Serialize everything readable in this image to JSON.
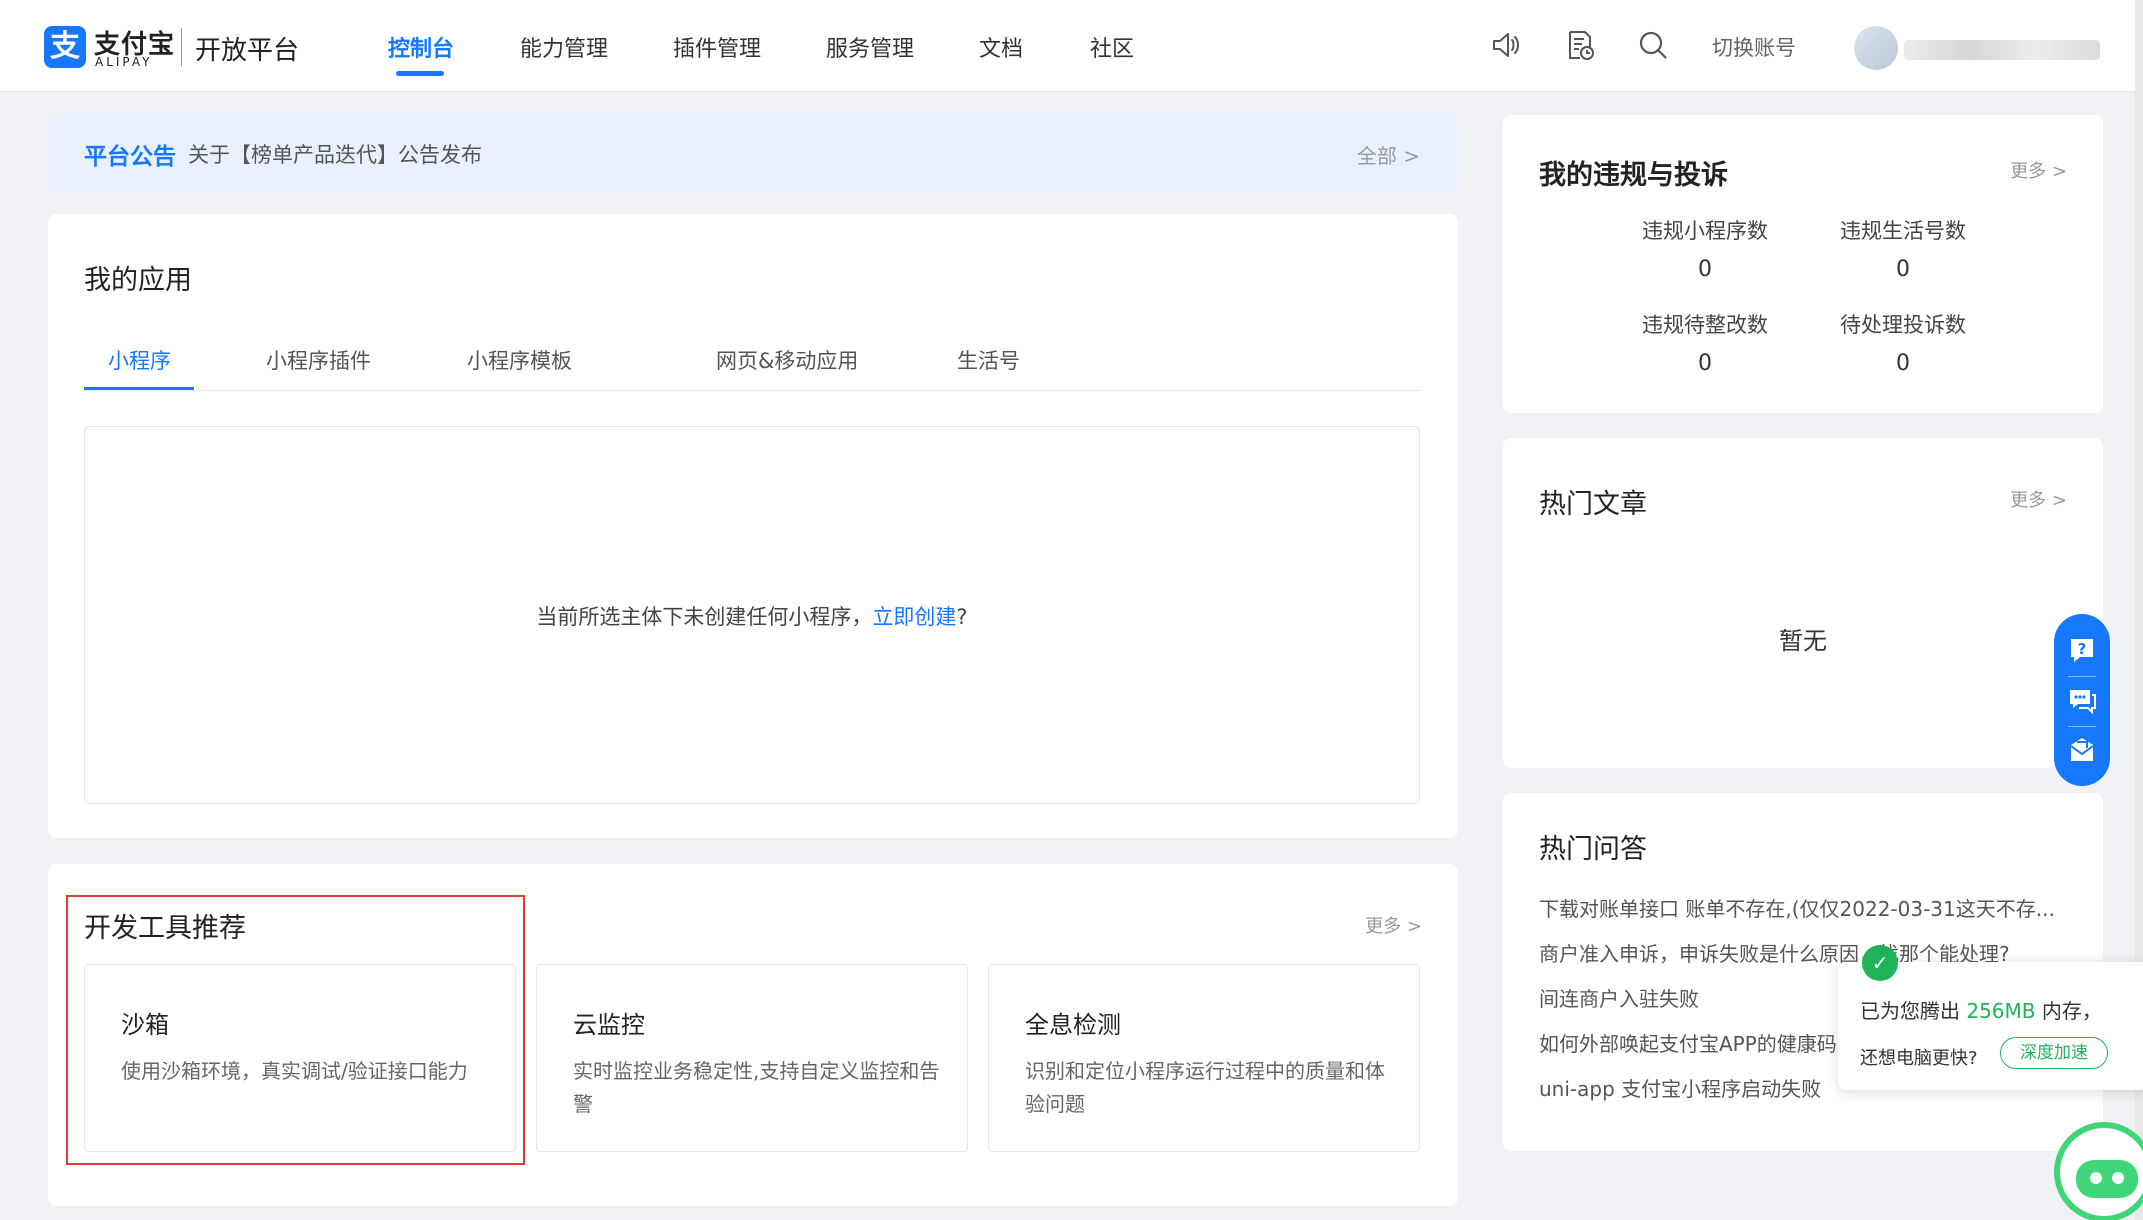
{
  "header": {
    "logo_mark": "支",
    "logo_cn": "支付宝",
    "logo_en": "ALIPAY",
    "platform": "开放平台",
    "nav": [
      {
        "label": "控制台",
        "active": true
      },
      {
        "label": "能力管理"
      },
      {
        "label": "插件管理"
      },
      {
        "label": "服务管理"
      },
      {
        "label": "文档"
      },
      {
        "label": "社区"
      }
    ],
    "icons": [
      "speaker-icon",
      "document-clock-icon",
      "search-icon"
    ],
    "switch_account": "切换账号"
  },
  "announcement": {
    "title": "平台公告",
    "text": "关于【榜单产品迭代】公告发布",
    "all": "全部 >"
  },
  "my_apps": {
    "title": "我的应用",
    "tabs": [
      "小程序",
      "小程序插件",
      "小程序模板",
      "网页&移动应用",
      "生活号"
    ],
    "active_tab": 0,
    "empty_text": "当前所选主体下未创建任何小程序，",
    "create_link": "立即创建",
    "question_mark": "?"
  },
  "dev_tools": {
    "title": "开发工具推荐",
    "more": "更多 >",
    "tools": [
      {
        "title": "沙箱",
        "desc": "使用沙箱环境，真实调试/验证接口能力"
      },
      {
        "title": "云监控",
        "desc": "实时监控业务稳定性,支持自定义监控和告警"
      },
      {
        "title": "全息检测",
        "desc": "识别和定位小程序运行过程中的质量和体验问题"
      }
    ]
  },
  "violations": {
    "title": "我的违规与投诉",
    "more": "更多 >",
    "stats": [
      {
        "label": "违规小程序数",
        "value": "0"
      },
      {
        "label": "违规生活号数",
        "value": "0"
      },
      {
        "label": "违规待整改数",
        "value": "0"
      },
      {
        "label": "待处理投诉数",
        "value": "0"
      }
    ]
  },
  "hot_articles": {
    "title": "热门文章",
    "more": "更多 >",
    "empty": "暂无"
  },
  "hot_qa": {
    "title": "热门问答",
    "items": [
      "下载对账单接口 账单不存在,(仅仅2022-03-31这天不存...",
      "商户准入申诉，申诉失败是什么原因，找那个能处理?",
      "间连商户入驻失败",
      "如何外部唤起支付宝APP的健康码",
      "uni-app 支付宝小程序启动失败"
    ]
  },
  "float_toolbar": [
    "help-icon",
    "chat-icon",
    "feedback-mail-icon"
  ],
  "popup": {
    "check": "✓",
    "prefix": "已为您腾出 ",
    "amount": "256MB",
    "suffix": " 内存，",
    "question": "还想电脑更快?",
    "button": "深度加速"
  },
  "colors": {
    "brand": "#1677ff",
    "success": "#1fb35a",
    "highlight_box": "#e23b3b"
  }
}
